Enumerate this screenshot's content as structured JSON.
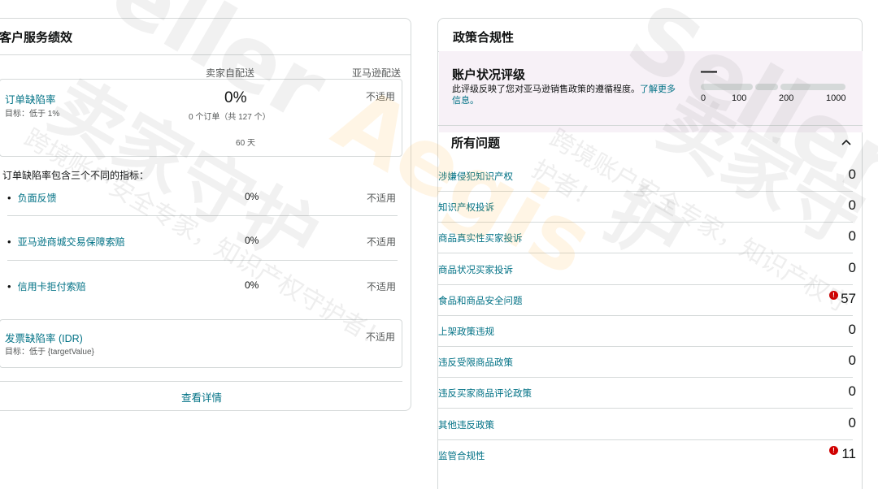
{
  "customer_service": {
    "title": "客户服务绩效",
    "col_seller": "卖家自配送",
    "col_amazon": "亚马逊配送",
    "odr": {
      "name": "订单缺陷率",
      "target": "目标：低于 1%",
      "seller_value": "0%",
      "seller_orders": "0 个订单（共 127 个）",
      "seller_period": "60 天",
      "amazon_value": "不适用"
    },
    "odr_note": "订单缺陷率包含三个不同的指标：",
    "sub_metrics": [
      {
        "name": "负面反馈",
        "seller": "0%",
        "amazon": "不适用"
      },
      {
        "name": "亚马逊商城交易保障索赔",
        "seller": "0%",
        "amazon": "不适用"
      },
      {
        "name": "信用卡拒付索赔",
        "seller": "0%",
        "amazon": "不适用"
      }
    ],
    "idr": {
      "name": "发票缺陷率 (IDR)",
      "target": "目标：低于 {targetValue}",
      "amazon_value": "不适用"
    },
    "view_details": "查看详情"
  },
  "policy": {
    "title": "政策合规性",
    "rating_title": "账户状况评级",
    "rating_desc": "此评级反映了您对亚马逊销售政策的遵循程度。",
    "rating_link": "了解更多信息。",
    "rating_value": "—",
    "rating_scale": [
      "0",
      "100",
      "200",
      "1000"
    ],
    "issues_title": "所有问题",
    "issues": [
      {
        "label": "涉嫌侵犯知识产权",
        "count": "0",
        "alert": false
      },
      {
        "label": "知识产权投诉",
        "count": "0",
        "alert": false
      },
      {
        "label": "商品真实性买家投诉",
        "count": "0",
        "alert": false
      },
      {
        "label": "商品状况买家投诉",
        "count": "0",
        "alert": false
      },
      {
        "label": "食品和商品安全问题",
        "count": "57",
        "alert": true
      },
      {
        "label": "上架政策违规",
        "count": "0",
        "alert": false
      },
      {
        "label": "违反受限商品政策",
        "count": "0",
        "alert": false
      },
      {
        "label": "违反买家商品评论政策",
        "count": "0",
        "alert": false
      },
      {
        "label": "其他违反政策",
        "count": "0",
        "alert": false
      },
      {
        "label": "监管合规性",
        "count": "11",
        "alert": true
      }
    ],
    "alert_glyph": "!"
  },
  "watermark": {
    "brand_a": "Seller ",
    "brand_b": "Aegis",
    "cn": "卖家守护",
    "slogan": "跨境账户安全专家，知识产权守护者！"
  },
  "colors": {
    "link": "#007185",
    "alert": "#d00000",
    "border": "#d5d9d9",
    "rating_bg": "#f7f1f7"
  }
}
